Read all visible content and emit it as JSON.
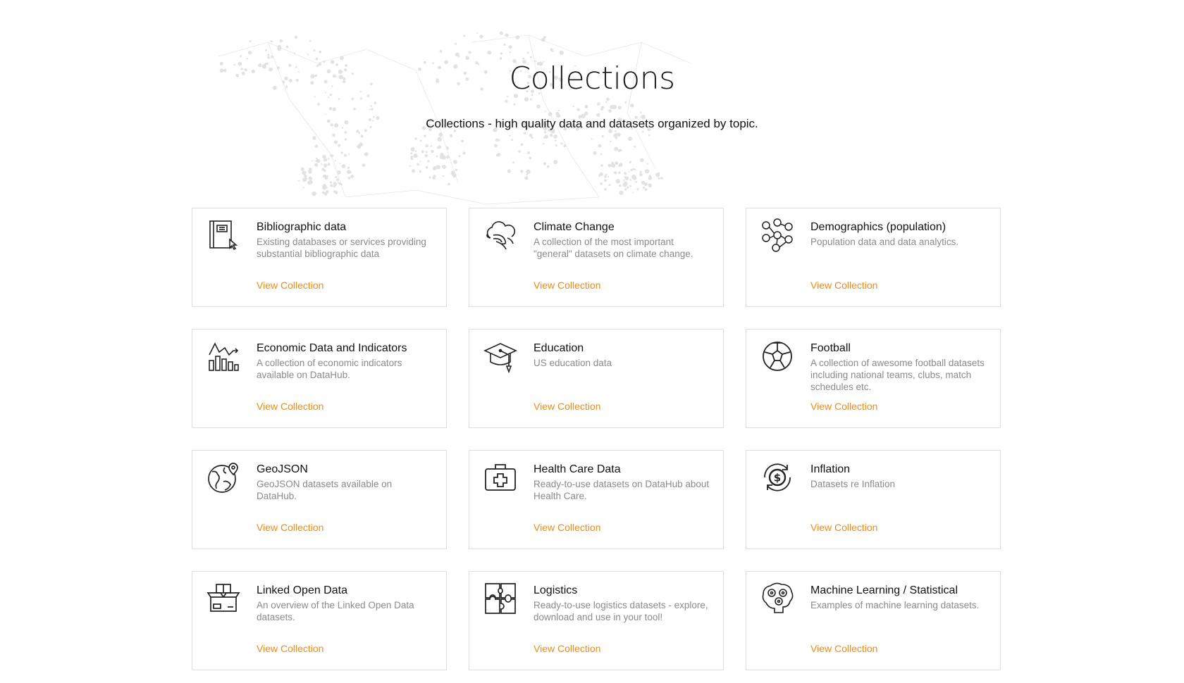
{
  "header": {
    "title": "Collections",
    "subtitle": "Collections - high quality data and datasets organized by topic."
  },
  "colors": {
    "accent": "#f28a12",
    "border": "#dedede",
    "muted_text": "#8a8a8a"
  },
  "collections": [
    {
      "title": "Bibliographic data",
      "description": "Existing databases or services providing substantial bibliographic data",
      "link": "View Collection",
      "icon": "book-cursor-icon"
    },
    {
      "title": "Climate Change",
      "description": "A collection of the most important \"general\" datasets on climate change.",
      "link": "View Collection",
      "icon": "cloud-wind-icon"
    },
    {
      "title": "Demographics (population)",
      "description": "Population data and data analytics.",
      "link": "View Collection",
      "icon": "people-network-icon"
    },
    {
      "title": "Economic Data and Indicators",
      "description": "A collection of economic indicators available on DataHub.",
      "link": "View Collection",
      "icon": "bar-chart-trend-icon"
    },
    {
      "title": "Education",
      "description": "US education data",
      "link": "View Collection",
      "icon": "graduation-cap-icon"
    },
    {
      "title": "Football",
      "description": "A collection of awesome football datasets including national teams, clubs, match schedules etc.",
      "link": "View Collection",
      "icon": "soccer-ball-icon"
    },
    {
      "title": "GeoJSON",
      "description": "GeoJSON datasets available on DataHub.",
      "link": "View Collection",
      "icon": "globe-pin-icon"
    },
    {
      "title": "Health Care Data",
      "description": "Ready-to-use datasets on DataHub about Health Care.",
      "link": "View Collection",
      "icon": "medical-kit-icon"
    },
    {
      "title": "Inflation",
      "description": "Datasets re Inflation",
      "link": "View Collection",
      "icon": "dollar-cycle-icon"
    },
    {
      "title": "Linked Open Data",
      "description": "An overview of the Linked Open Data datasets.",
      "link": "View Collection",
      "icon": "open-box-icon"
    },
    {
      "title": "Logistics",
      "description": "Ready-to-use logistics datasets - explore, download and use in your tool!",
      "link": "View Collection",
      "icon": "puzzle-icon"
    },
    {
      "title": "Machine Learning / Statistical",
      "description": "Examples of machine learning datasets.",
      "link": "View Collection",
      "icon": "brain-gears-icon"
    }
  ]
}
